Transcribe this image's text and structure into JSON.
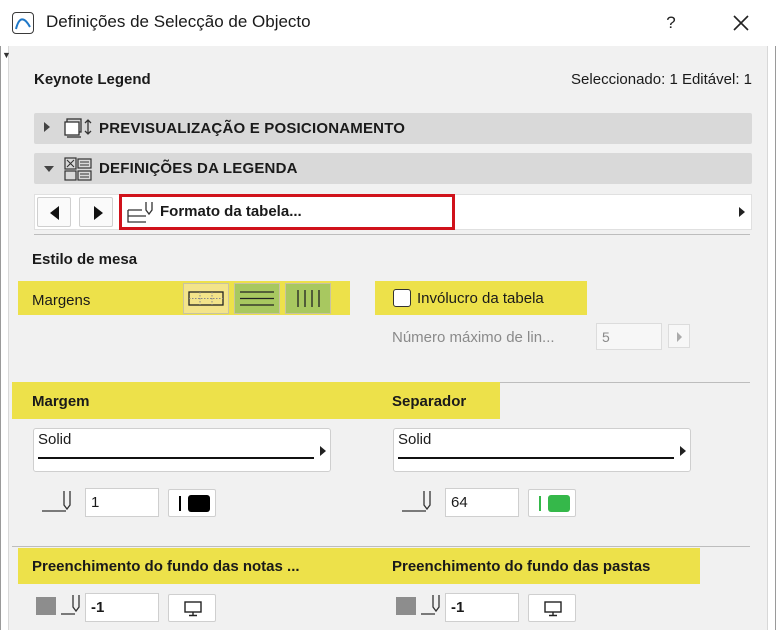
{
  "window": {
    "title": "Definições de Selecção de Objecto",
    "help_label": "?"
  },
  "header": {
    "object_name": "Keynote Legend",
    "selection_info": "Seleccionado: 1 Editável: 1"
  },
  "sections": [
    {
      "label": "PREVISUALIZAÇÃO E POSICIONAMENTO",
      "expanded": false
    },
    {
      "label": "DEFINIÇÕES DA LEGENDA",
      "expanded": true
    }
  ],
  "page_nav": {
    "current_page": "Formato da tabela..."
  },
  "table_style": {
    "title": "Estilo de mesa",
    "margins_label": "Margens",
    "wrap_checkbox_label": "Invólucro da tabela",
    "wrap_checked": false,
    "max_lines_label": "Número máximo de lin...",
    "max_lines_value": "5"
  },
  "margin_group": {
    "title": "Margem",
    "line_type": "Solid",
    "pen_value": "1",
    "color": "#000000"
  },
  "separator_group": {
    "title": "Separador",
    "line_type": "Solid",
    "pen_value": "64",
    "color": "#35b84a"
  },
  "fill_notes": {
    "title": "Preenchimento do fundo das notas ...",
    "pen_value": "-1"
  },
  "fill_folders": {
    "title": "Preenchimento do fundo das pastas",
    "pen_value": "-1"
  },
  "colors": {
    "highlight": "#ede14a",
    "red_border": "#d0121b",
    "section_bg": "#d9d9d9"
  }
}
